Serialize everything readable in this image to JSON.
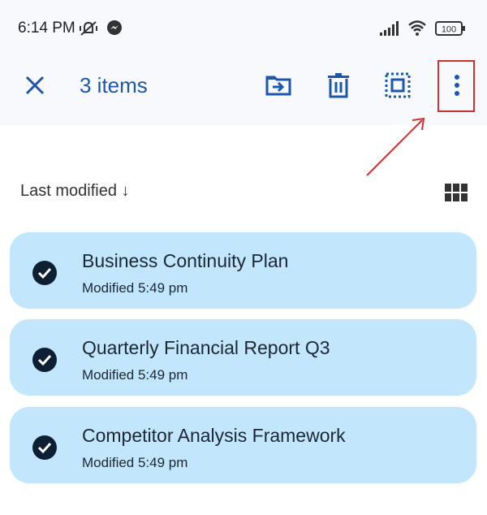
{
  "status_bar": {
    "time": "6:14 PM",
    "battery": "100",
    "icons": [
      "vibrate-mute-icon",
      "messenger-icon",
      "signal-icon",
      "wifi-icon",
      "battery-icon"
    ]
  },
  "toolbar": {
    "selection_count": "3 items",
    "actions": [
      "close",
      "move-to-folder",
      "delete",
      "select-all",
      "more-options"
    ]
  },
  "sort": {
    "label": "Last modified",
    "direction": "↓"
  },
  "files": [
    {
      "name": "Business Continuity Plan",
      "modified": "Modified 5:49 pm",
      "selected": true
    },
    {
      "name": "Quarterly Financial Report Q3",
      "modified": "Modified 5:49 pm",
      "selected": true
    },
    {
      "name": "Competitor Analysis Framework",
      "modified": "Modified 5:49 pm",
      "selected": true
    }
  ],
  "colors": {
    "accent": "#1a57b0",
    "card_bg": "#c2e6fc",
    "highlight": "#d32f2f"
  }
}
